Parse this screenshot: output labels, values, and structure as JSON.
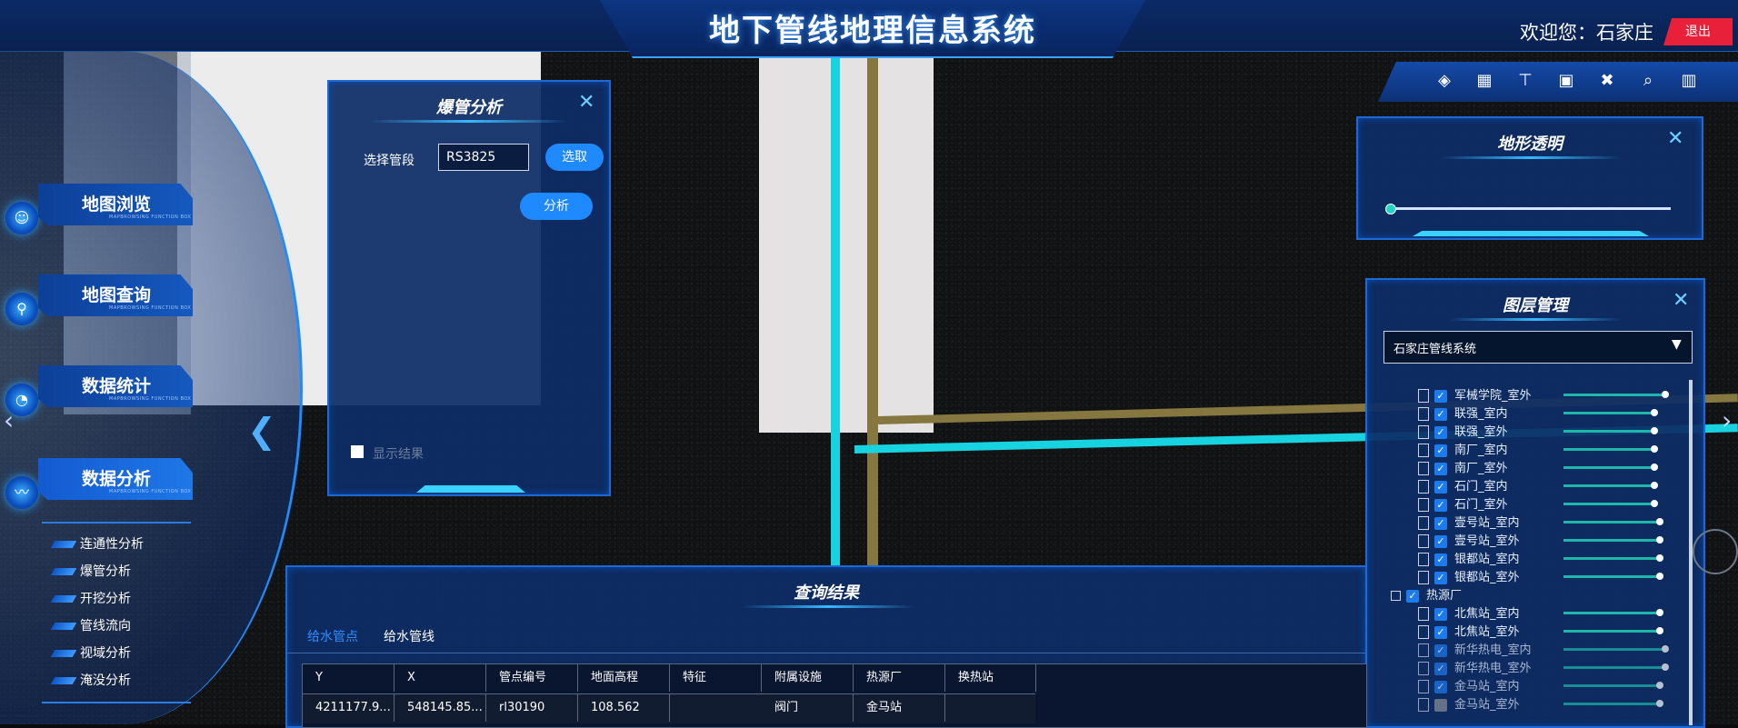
{
  "header": {
    "title": "地下管线地理信息系统",
    "welcome": "欢迎您：石家庄",
    "logout": "退出"
  },
  "left_nav": {
    "items": [
      {
        "label": "地图浏览",
        "sub": "MAPBROWSING FUNCTION BOX"
      },
      {
        "label": "地图查询",
        "sub": "MAPBROWSING FUNCTION BOX"
      },
      {
        "label": "数据统计",
        "sub": "MAPBROWSING FUNCTION BOX"
      },
      {
        "label": "数据分析",
        "sub": "MAPBROWSING FUNCTION BOX"
      }
    ],
    "sub_items": [
      "连通性分析",
      "爆管分析",
      "开挖分析",
      "管线流向",
      "视域分析",
      "淹没分析"
    ]
  },
  "burst_panel": {
    "title": "爆管分析",
    "select_label": "选择管段",
    "segment_value": "RS3825",
    "pick_button": "选取",
    "analyze_button": "分析",
    "show_result_label": "显示结果"
  },
  "terrain_panel": {
    "title": "地形透明",
    "transparency": 0
  },
  "layer_panel": {
    "title": "图层管理",
    "dropdown_value": "石家庄管线系统",
    "rows": [
      {
        "label": "军械学院_室外",
        "checked": true,
        "level": 0.6
      },
      {
        "label": "联强_室内",
        "checked": true,
        "level": 0.5
      },
      {
        "label": "联强_室外",
        "checked": true,
        "level": 0.5
      },
      {
        "label": "南厂_室内",
        "checked": true,
        "level": 0.5
      },
      {
        "label": "南厂_室外",
        "checked": true,
        "level": 0.5
      },
      {
        "label": "石门_室内",
        "checked": true,
        "level": 0.5
      },
      {
        "label": "石门_室外",
        "checked": true,
        "level": 0.5
      },
      {
        "label": "壹号站_室内",
        "checked": true,
        "level": 0.55
      },
      {
        "label": "壹号站_室外",
        "checked": true,
        "level": 0.55
      },
      {
        "label": "银都站_室内",
        "checked": true,
        "level": 0.55
      },
      {
        "label": "银都站_室外",
        "checked": true,
        "level": 0.55
      },
      {
        "label": "热源厂",
        "checked": true,
        "group": true
      },
      {
        "label": "北焦站_室内",
        "checked": true,
        "level": 0.55
      },
      {
        "label": "北焦站_室外",
        "checked": true,
        "level": 0.55
      },
      {
        "label": "新华热电_室内",
        "checked": true,
        "level": 0.6
      },
      {
        "label": "新华热电_室外",
        "checked": true,
        "level": 0.6
      },
      {
        "label": "金马站_室内",
        "checked": true,
        "level": 0.55
      },
      {
        "label": "金马站_室外",
        "checked": false,
        "level": 0.55
      }
    ]
  },
  "results": {
    "title": "查询结果",
    "tabs": [
      "给水管点",
      "给水管线"
    ],
    "columns": [
      "Y",
      "X",
      "管点编号",
      "地面高程",
      "特征",
      "附属设施",
      "热源厂",
      "换热站"
    ],
    "rows": [
      [
        "4211177.9...",
        "548145.85...",
        "rl30190",
        "108.562",
        "",
        "阀门",
        "金马站",
        ""
      ]
    ]
  },
  "colors": {
    "accent": "#1f89ff",
    "panel": "#0d2d66",
    "pipe_cyan": "#18d6e0",
    "pipe_brown": "#8a7a4a",
    "logout": "#e8203a"
  },
  "toolbar_icons": [
    "layers-icon",
    "qr-grid-icon",
    "measure-icon",
    "image-icon",
    "tools-icon",
    "search-icon",
    "split-view-icon"
  ]
}
